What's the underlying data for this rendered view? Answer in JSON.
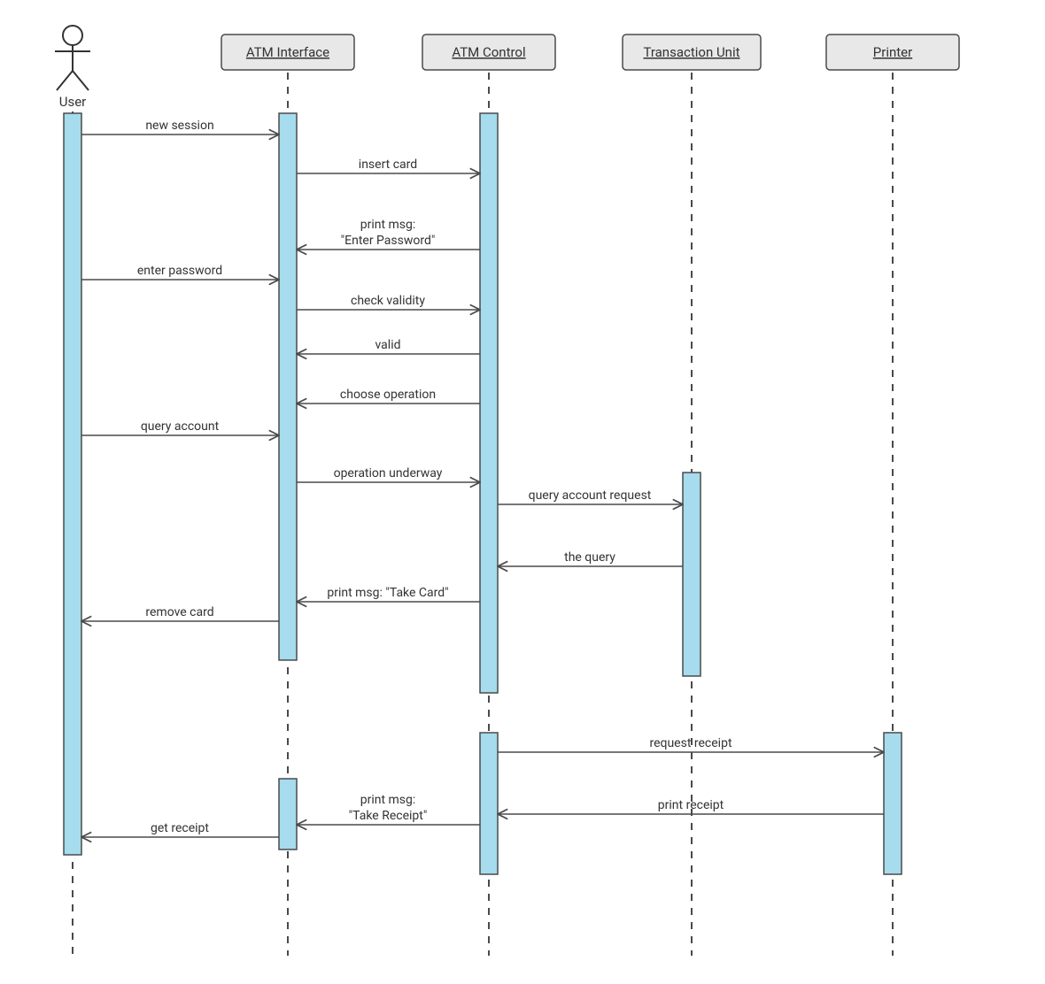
{
  "actors": {
    "user": "User",
    "atm_interface": "ATM Interface",
    "atm_control": "ATM Control",
    "transaction_unit": "Transaction Unit",
    "printer": "Printer"
  },
  "messages": {
    "m1": "new session",
    "m2": "insert card",
    "m3a": "print msg:",
    "m3b": "\"Enter Password\"",
    "m4": "enter password",
    "m5": "check validity",
    "m6": "valid",
    "m7": "choose operation",
    "m8": "query account",
    "m9": "operation underway",
    "m10": "query account request",
    "m11": "the query",
    "m12": "print msg: \"Take Card\"",
    "m13": "remove card",
    "m14": "request receipt",
    "m15": "print receipt",
    "m16a": "print msg:",
    "m16b": "\"Take Receipt\"",
    "m17": "get receipt"
  }
}
